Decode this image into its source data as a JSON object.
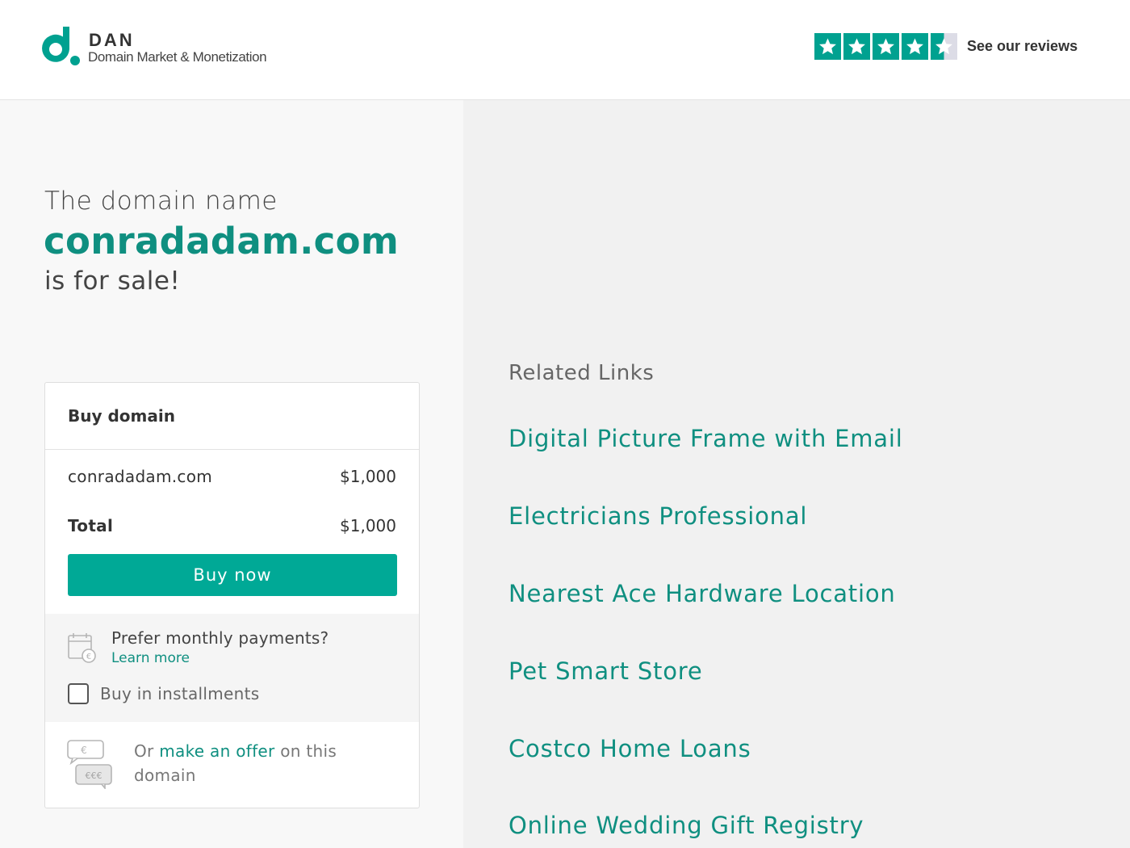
{
  "header": {
    "brand": "DAN",
    "tagline": "Domain Market & Monetization",
    "rating_stars": 4.5,
    "reviews_link": "See our reviews",
    "accent_color": "#00a190"
  },
  "hero": {
    "pre": "The domain name",
    "domain": "conradadam.com",
    "post": "is for sale!"
  },
  "card": {
    "title": "Buy domain",
    "item_label": "conradadam.com",
    "item_price": "$1,000",
    "total_label": "Total",
    "total_price": "$1,000",
    "buy_button": "Buy now",
    "monthly_question": "Prefer monthly payments?",
    "learn_more": "Learn more",
    "installments_label": "Buy in installments",
    "installments_checked": false,
    "offer_prefix": "Or",
    "offer_link": "make an offer",
    "offer_suffix": "on this domain"
  },
  "related": {
    "title": "Related Links",
    "links": [
      "Digital Picture Frame with Email",
      "Electricians Professional",
      "Nearest Ace Hardware Location",
      "Pet Smart Store",
      "Costco Home Loans",
      "Online Wedding Gift Registry"
    ]
  }
}
